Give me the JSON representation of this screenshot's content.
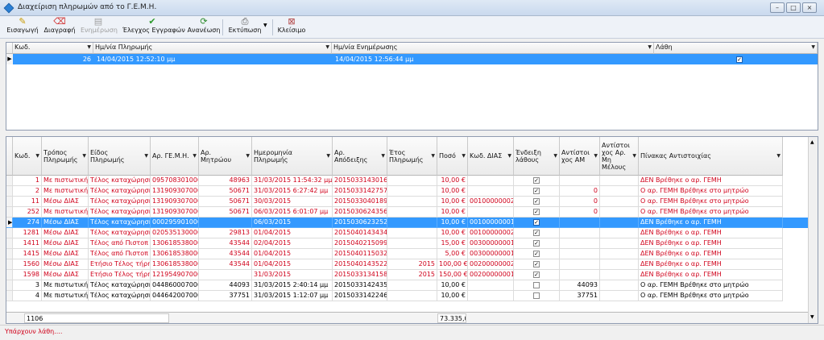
{
  "window": {
    "title": "Διαχείριση πληρωμών από το Γ.Ε.Μ.Η."
  },
  "toolbar": {
    "insert": "Εισαγωγή",
    "delete": "Διαγραφή",
    "update": "Ενημέρωση",
    "check_errors": "Έλεγχος Εγγραφών",
    "refresh": "Ανανέωση",
    "print": "Εκτύπωση",
    "close": "Κλείσιμο"
  },
  "top_grid": {
    "headers": [
      "Κωδ.",
      "Ημ/νία Πληρωμής",
      "Ημ/νία Ενημέρωσης",
      "Λάθη"
    ],
    "row": {
      "code": "26",
      "payment_date": "14/04/2015 12:52:10 μμ",
      "update_date": "14/04/2015 12:56:44 μμ",
      "errors": true
    }
  },
  "main_grid": {
    "headers": [
      "Κωδ.",
      "Τρόπος Πληρωμής",
      "Είδος Πληρωμής",
      "Αρ. ΓΕ.Μ.Η.",
      "Αρ. Μητρώου",
      "Ημερομηνία Πληρωμής",
      "Αρ. Απόδειξης",
      "Έτος Πληρωμής",
      "Ποσό",
      "Κωδ. ΔΙΑΣ",
      "Ένδειξη λάθους",
      "Αντίστοι χος ΑΜ",
      "Αντίστοι χος Αρ. Μη Μέλους",
      "Πίνακας Αντιστοιχίας"
    ],
    "rows": [
      {
        "code": "1",
        "mode": "Με πιστωτική κ",
        "type": "Τέλος καταχώρηση",
        "gemh": "095708301000",
        "am": "48963",
        "date": "31/03/2015 11:54:32 μμ",
        "receipt": "2015033143016",
        "year": "",
        "amount": "10,00 €",
        "dias": "",
        "err": true,
        "am2": "",
        "nonmember": "",
        "table": "ΔΕΝ Βρέθηκε ο αρ. ΓΕΜΗ",
        "style": "red"
      },
      {
        "code": "2",
        "mode": "Με πιστωτική κ",
        "type": "Τέλος καταχώρηση",
        "gemh": "131909307000",
        "am": "50671",
        "date": "31/03/2015 6:27:42 μμ",
        "receipt": "2015033142757",
        "year": "",
        "amount": "10,00 €",
        "dias": "",
        "err": true,
        "am2": "0",
        "nonmember": "",
        "table": "Ο αρ. ΓΕΜΗ Βρέθηκε στο μητρώο",
        "style": "red"
      },
      {
        "code": "11",
        "mode": "Μέσω ΔΙΑΣ",
        "type": "Τέλος καταχώρηση",
        "gemh": "131909307000",
        "am": "50671",
        "date": "30/03/2015",
        "receipt": "2015033040189",
        "year": "",
        "amount": "10,00 €",
        "dias": "00100000002",
        "err": true,
        "am2": "0",
        "nonmember": "",
        "table": "Ο αρ. ΓΕΜΗ Βρέθηκε στο μητρώο",
        "style": "red"
      },
      {
        "code": "252",
        "mode": "Με πιστωτική κ",
        "type": "Τέλος καταχώρηση",
        "gemh": "131909307000",
        "am": "50671",
        "date": "06/03/2015 6:01:07 μμ",
        "receipt": "2015030624356",
        "year": "",
        "amount": "10,00 €",
        "dias": "",
        "err": true,
        "am2": "0",
        "nonmember": "",
        "table": "Ο αρ. ΓΕΜΗ Βρέθηκε στο μητρώο",
        "style": "red"
      },
      {
        "code": "274",
        "mode": "Μέσω ΔΙΑΣ",
        "type": "Τέλος καταχώρηση",
        "gemh": "000295901000",
        "am": "",
        "date": "06/03/2015",
        "receipt": "2015030623252",
        "year": "",
        "amount": "10,00 €",
        "dias": "00100000001",
        "err": true,
        "am2": "",
        "nonmember": "",
        "table": "ΔΕΝ Βρέθηκε ο αρ. ΓΕΜΗ",
        "style": "sel"
      },
      {
        "code": "1281",
        "mode": "Μέσω ΔΙΑΣ",
        "type": "Τέλος καταχώρηση",
        "gemh": "020535130000",
        "am": "29813",
        "date": "01/04/2015",
        "receipt": "2015040143434",
        "year": "",
        "amount": "10,00 €",
        "dias": "00100000002",
        "err": true,
        "am2": "",
        "nonmember": "",
        "table": "ΔΕΝ Βρέθηκε ο αρ. ΓΕΜΗ",
        "style": "red"
      },
      {
        "code": "1411",
        "mode": "Μέσω ΔΙΑΣ",
        "type": "Τέλος από Πιστοπ",
        "gemh": "130618538000",
        "am": "43544",
        "date": "02/04/2015",
        "receipt": "2015040215099",
        "year": "",
        "amount": "15,00 €",
        "dias": "00300000001",
        "err": true,
        "am2": "",
        "nonmember": "",
        "table": "ΔΕΝ Βρέθηκε ο αρ. ΓΕΜΗ",
        "style": "red"
      },
      {
        "code": "1415",
        "mode": "Μέσω ΔΙΑΣ",
        "type": "Τέλος από Πιστοπ",
        "gemh": "130618538000",
        "am": "43544",
        "date": "01/04/2015",
        "receipt": "2015040115032",
        "year": "",
        "amount": "5,00 €",
        "dias": "00300000001",
        "err": true,
        "am2": "",
        "nonmember": "",
        "table": "ΔΕΝ Βρέθηκε ο αρ. ΓΕΜΗ",
        "style": "red"
      },
      {
        "code": "1560",
        "mode": "Μέσω ΔΙΑΣ",
        "type": "Ετήσιο Τέλος τήρη",
        "gemh": "130618538000",
        "am": "43544",
        "date": "01/04/2015",
        "receipt": "2015040143522",
        "year": "2015",
        "amount": "100,00 €",
        "dias": "00200000002",
        "err": true,
        "am2": "",
        "nonmember": "",
        "table": "ΔΕΝ Βρέθηκε ο αρ. ΓΕΜΗ",
        "style": "red"
      },
      {
        "code": "1598",
        "mode": "Μέσω ΔΙΑΣ",
        "type": "Ετήσιο Τέλος τήρη",
        "gemh": "121954907000",
        "am": "",
        "date": "31/03/2015",
        "receipt": "2015033134158",
        "year": "2015",
        "amount": "150,00 €",
        "dias": "00200000001",
        "err": true,
        "am2": "",
        "nonmember": "",
        "table": "ΔΕΝ Βρέθηκε ο αρ. ΓΕΜΗ",
        "style": "red"
      },
      {
        "code": "3",
        "mode": "Με πιστωτική κ",
        "type": "Τέλος καταχώρηση",
        "gemh": "044860007000",
        "am": "44093",
        "date": "31/03/2015 2:40:14 μμ",
        "receipt": "2015033142435",
        "year": "",
        "amount": "10,00 €",
        "dias": "",
        "err": false,
        "am2": "44093",
        "nonmember": "",
        "table": "Ο αρ. ΓΕΜΗ Βρέθηκε στο μητρώο",
        "style": ""
      },
      {
        "code": "4",
        "mode": "Με πιστωτική κ",
        "type": "Τέλος καταχώρηση",
        "gemh": "044642007000",
        "am": "37751",
        "date": "31/03/2015 1:12:07 μμ",
        "receipt": "2015033142246",
        "year": "",
        "amount": "10,00 €",
        "dias": "",
        "err": false,
        "am2": "37751",
        "nonmember": "",
        "table": "Ο αρ. ΓΕΜΗ Βρέθηκε στο μητρώο",
        "style": ""
      }
    ],
    "footer": {
      "count": "1106",
      "total": "73.335,0"
    }
  },
  "status": {
    "message": "Υπάρχουν λάθη...."
  },
  "colors": {
    "selection": "#3399ff",
    "error_text": "#d0021b"
  }
}
